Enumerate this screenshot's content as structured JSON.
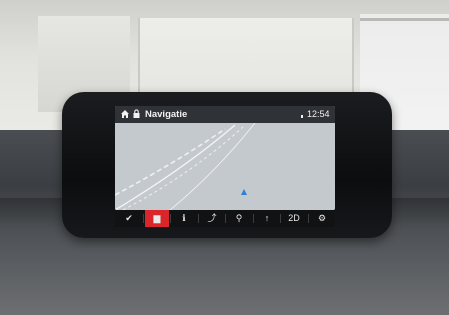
{
  "screen": {
    "header": {
      "title": "Navigatie",
      "time": "12:54",
      "icons": [
        "home-icon",
        "lock-icon",
        "signal-icon"
      ]
    },
    "bottom_bar": {
      "buttons": [
        {
          "name": "check-icon",
          "glyph": "✔",
          "active": false
        },
        {
          "name": "map-flag-icon",
          "glyph": "▆",
          "active": true
        },
        {
          "name": "info-icon",
          "glyph": "ℹ",
          "active": false
        },
        {
          "name": "route-icon",
          "glyph": "⤴",
          "active": false
        },
        {
          "name": "pin-icon",
          "glyph": "⚲",
          "active": false
        },
        {
          "name": "exit-icon",
          "glyph": "↑",
          "active": false
        },
        {
          "name": "view-2d-icon",
          "glyph": "2D",
          "active": false
        },
        {
          "name": "settings-icon",
          "glyph": "⚙",
          "active": false
        }
      ]
    },
    "colors": {
      "active_button": "#d8262b",
      "map_background": "#c2c7cc",
      "position_marker": "#2f7fd6"
    }
  }
}
